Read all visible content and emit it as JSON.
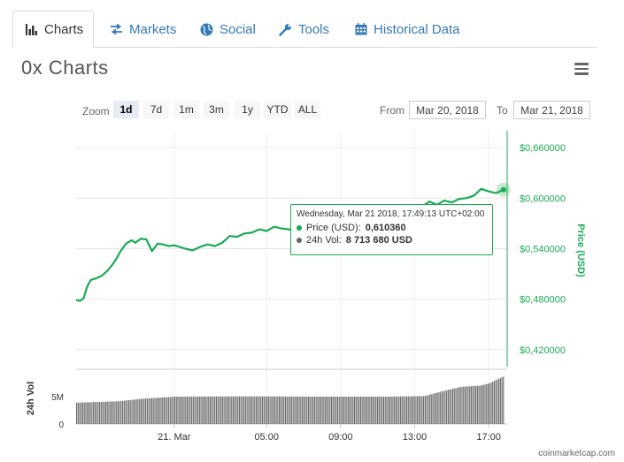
{
  "tabs": [
    {
      "label": "Charts",
      "icon": "bar-chart-icon"
    },
    {
      "label": "Markets",
      "icon": "exchange-arrows-icon"
    },
    {
      "label": "Social",
      "icon": "globe-icon"
    },
    {
      "label": "Tools",
      "icon": "wrench-icon"
    },
    {
      "label": "Historical Data",
      "icon": "calendar-icon"
    }
  ],
  "title": "0x Charts",
  "zoom": {
    "label": "Zoom",
    "options": [
      "1d",
      "7d",
      "1m",
      "3m",
      "1y",
      "YTD",
      "ALL"
    ],
    "selected": "1d"
  },
  "range": {
    "from_label": "From",
    "from": "Mar 20, 2018",
    "to_label": "To",
    "to": "Mar 21, 2018"
  },
  "tooltip": {
    "header": "Wednesday, Mar 21 2018, 17:49:13 UTC+02:00",
    "price_label": "Price (USD):",
    "price_value": "0,610360",
    "vol_label": "24h Vol:",
    "vol_value": "8 713 680 USD"
  },
  "credit": "coinmarketcap.com",
  "colors": {
    "price": "#1aaa55",
    "volume": "#666666",
    "grid": "#e6e6e6",
    "axis_text": "#1aaa55"
  },
  "chart_data": [
    {
      "type": "line",
      "ylabel": "Price (USD)",
      "y_tick_labels": [
        "$0,420000",
        "$0,480000",
        "$0,540000",
        "$0,600000",
        "$0,660000"
      ],
      "y_ticks": [
        0.42,
        0.48,
        0.54,
        0.6,
        0.66
      ],
      "ylim": [
        0.4,
        0.68
      ],
      "x_tick_labels": [
        "21. Mar",
        "05:00",
        "09:00",
        "13:00",
        "17:00"
      ],
      "x_ticks": [
        0,
        5,
        9,
        13,
        17
      ],
      "xlim": [
        -5.3,
        18.0
      ],
      "series": [
        {
          "x": [
            -5.3,
            -5.1,
            -4.9,
            -4.7,
            -4.5,
            -4.2,
            -3.9,
            -3.6,
            -3.3,
            -3.1,
            -2.9,
            -2.6,
            -2.3,
            -2.1,
            -1.8,
            -1.5,
            -1.2,
            -0.9,
            -0.6,
            -0.3,
            0,
            0.3,
            0.6,
            1.0,
            1.4,
            1.8,
            2.2,
            2.6,
            3.0,
            3.4,
            3.8,
            4.2,
            4.6,
            5.0,
            5.4,
            5.8,
            6.2,
            6.6,
            7.0,
            7.4,
            7.8,
            8.2,
            8.6,
            9.0,
            9.4,
            9.8,
            10.2,
            10.6,
            11.0,
            11.4,
            11.8,
            12.2,
            12.6,
            13.0,
            13.4,
            13.8,
            14.2,
            14.6,
            15.0,
            15.4,
            15.8,
            16.2,
            16.6,
            17.0,
            17.4,
            17.8
          ],
          "y": [
            0.479,
            0.478,
            0.481,
            0.495,
            0.503,
            0.505,
            0.508,
            0.514,
            0.522,
            0.529,
            0.537,
            0.546,
            0.55,
            0.547,
            0.552,
            0.551,
            0.537,
            0.546,
            0.545,
            0.543,
            0.544,
            0.542,
            0.54,
            0.538,
            0.542,
            0.545,
            0.543,
            0.547,
            0.555,
            0.554,
            0.558,
            0.559,
            0.563,
            0.561,
            0.566,
            0.564,
            0.563,
            0.561,
            0.562,
            0.565,
            0.563,
            0.557,
            0.551,
            0.548,
            0.549,
            0.552,
            0.553,
            0.555,
            0.556,
            0.558,
            0.562,
            0.571,
            0.575,
            0.584,
            0.59,
            0.596,
            0.592,
            0.597,
            0.595,
            0.599,
            0.6,
            0.603,
            0.611,
            0.608,
            0.606,
            0.61
          ]
        }
      ]
    },
    {
      "type": "bar",
      "ylabel": "24h Vol",
      "y_tick_labels": [
        "0",
        "5M"
      ],
      "y_ticks": [
        0,
        5000000
      ],
      "ylim": [
        0,
        10000000
      ],
      "series": [
        {
          "name": "24h Vol",
          "x_start": -5.3,
          "x_end": 17.8,
          "values_at": [
            [
              -5.3,
              3900000
            ],
            [
              -3.0,
              4150000
            ],
            [
              -1.8,
              4600000
            ],
            [
              0.0,
              5000000
            ],
            [
              4.0,
              5050000
            ],
            [
              8.0,
              5000000
            ],
            [
              11.5,
              5000000
            ],
            [
              13.5,
              5100000
            ],
            [
              14.5,
              6000000
            ],
            [
              15.5,
              6800000
            ],
            [
              16.5,
              7000000
            ],
            [
              17.0,
              7400000
            ],
            [
              17.8,
              8713680
            ]
          ]
        }
      ]
    }
  ]
}
